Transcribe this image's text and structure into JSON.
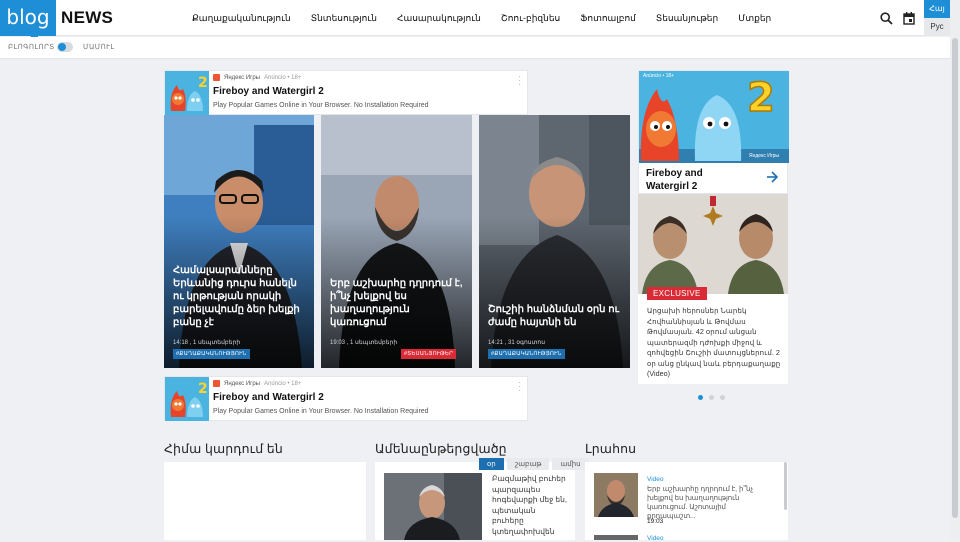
{
  "header": {
    "logo_blog": "blog",
    "logo_news": "NEWS",
    "nav": [
      "Քաղաքականություն",
      "Տնտեսություն",
      "Հասարակություն",
      "Շոու-բիզնես",
      "Ֆոտոալբոմ",
      "Տեսանյութեր",
      "Մտքեր"
    ],
    "lang_active": "Հայ",
    "lang_other": "Рус",
    "search_icon": "search-icon",
    "calendar_icon": "calendar-icon"
  },
  "subbar": {
    "left": "ԲԼՈԳՈԼՈՐՏ",
    "right": "ՄԱՄՈՒԼ"
  },
  "ad": {
    "source": "Яндекс Игры",
    "label": "Anúncio • 18+",
    "title": "Fireboy and Watergirl 2",
    "desc": "Play Popular Games Online in Your Browser. No Installation Required"
  },
  "featured": [
    {
      "headline": "Համալսարանները Երևանից դուրս հանելն ու կրթության որակի բարելավումը ձեր խելքի բանը չէ",
      "meta": "14:18 , 1 սեպտեմբերի",
      "tag": "#ՔԱՂԱՔԱԿԱՆՈՒԹՅՈՒՆ",
      "tag_color": "#1e6fb0"
    },
    {
      "headline": "Երբ աշխարհը դղրդում է, ի՞նչ խելքով ես խաղաղություն կառուցում",
      "meta": "19:03 , 1 սեպտեմբերի",
      "tag": "#ՏԵՍԱՆՅՈՒԹԵՐ",
      "tag_color": "#d92a36"
    },
    {
      "headline": "Շուշիի հանձնման օրն ու ժամը հայտնի են",
      "meta": "14:21 , 31 օգոստոս",
      "tag": "#ՔԱՂԱՔԱԿԱՆՈՒԹՅՈՒՆ",
      "tag_color": "#1e6fb0"
    }
  ],
  "sidebar_ad": {
    "label": "Anúncio • 18+",
    "source": "Яндекс Игры",
    "title": "Fireboy and Watergirl 2",
    "arrow_icon": "arrow-right-icon"
  },
  "exclusive": {
    "badge": "EXCLUSIVE",
    "text": "Արցախի հերոսներ Նարեկ Հովհաննիսյան և Թովմաս Թովմասյան. 42 օրում անցան պատերազմի դժոխքի միջով և զոհվեցին Շուշիի մատույցներում. 2 օր անց ընկավ նաև բերդաքաղաքը (Video)"
  },
  "sections": {
    "now_reading": "Հիմա կարդում են",
    "most_viewed": "Ամենաընթերցվածը",
    "live": "Լրահոս"
  },
  "most_viewed": {
    "tabs": [
      "օր",
      "շաբաթ",
      "ամիս"
    ],
    "item_text": "Բազմաթիվ բուհեր պարզապես հոգեվարքի մեջ են, պետական բուհերը կտեղափոխվեն"
  },
  "live": [
    {
      "category": "Video",
      "text": "Երբ աշխարհը դղրդում է, ի՞նչ խելքով ես խաղաղություն կառուցում. Աշոտայիմ քրդապաշտ...",
      "time": "19:03"
    },
    {
      "category": "Video",
      "text": "",
      "time": ""
    }
  ],
  "colors": {
    "brand": "#1e8fd6",
    "exclusive": "#d92a36",
    "tag_blue": "#1e6fb0"
  }
}
